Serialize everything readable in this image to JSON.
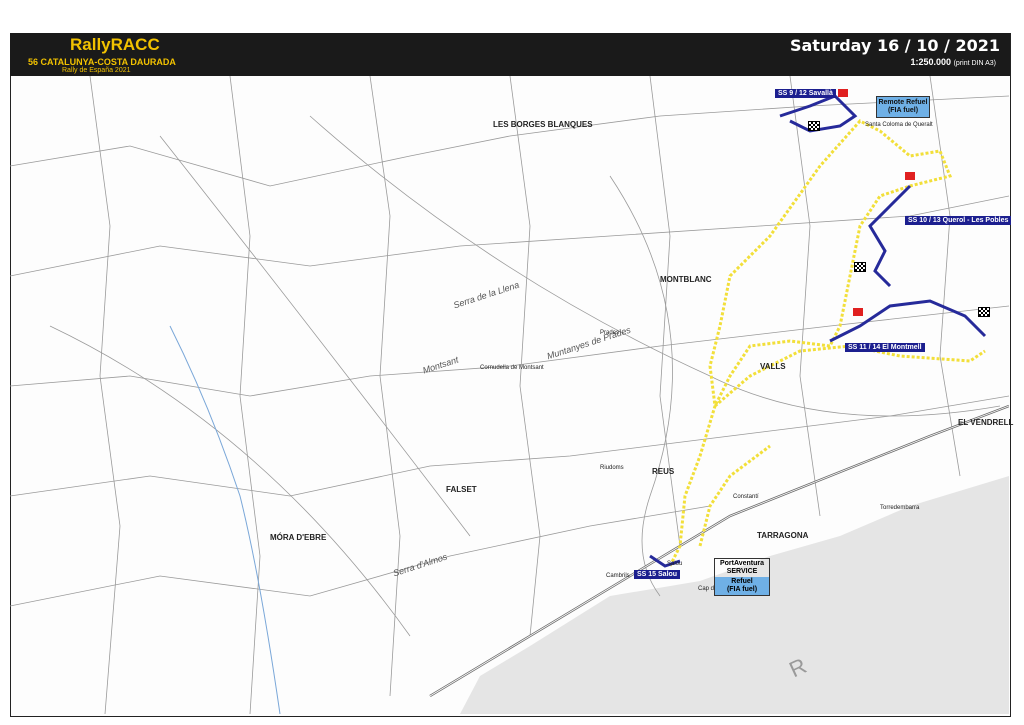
{
  "header": {
    "brand": "RallyRACC",
    "event": "56 CATALUNYA-COSTA DAURADA",
    "subtitle": "Rally de España 2021",
    "date": "Saturday 16 / 10 / 2021",
    "scale": "1:250.000",
    "scale_note": "(print DIN A3)"
  },
  "stages": {
    "ss9": "SS 9 / 12 Savallà",
    "ss10": "SS 10 / 13 Querol - Les Pobles",
    "ss11": "SS 11 / 14 El Montmell",
    "ss15": "SS 15 Salou"
  },
  "remote_refuel": {
    "line1": "Remote Refuel",
    "line2": "(FIA fuel)"
  },
  "service": {
    "line1": "PortAventura",
    "line2": "SERVICE",
    "line3": "Refuel",
    "line4": "(FIA fuel)"
  },
  "places": {
    "les_borges": "LES BORGES BLANQUES",
    "montblanc": "MONTBLANC",
    "valls": "VALLS",
    "reus": "REUS",
    "constanti": "Constantí",
    "tarragona": "TARRAGONA",
    "cambrils": "Cambrils",
    "salou": "Salou",
    "mora": "MÓRA D'EBRE",
    "vendrell": "EL VENDRELL",
    "prades": "Prades",
    "falset": "FALSET",
    "cornudella": "Cornudella de Montsant",
    "santa_coloma": "Santa Coloma de Queralt",
    "riudoms": "Riudoms",
    "torredembarra": "Torredembarra",
    "montsant": "Montsant",
    "muntanyes": "Muntanyes de Prades",
    "serra_llena": "Serra de la Llena",
    "serra_almos": "Serra d'Almos",
    "cap_salou": "Cap de Salou",
    "sea_letter": "R"
  },
  "colors": {
    "route": "#f2df3a",
    "stage": "#262a9a",
    "header": "#1a1a1a",
    "brand": "#f2c200",
    "sea": "#e5e5e5"
  }
}
